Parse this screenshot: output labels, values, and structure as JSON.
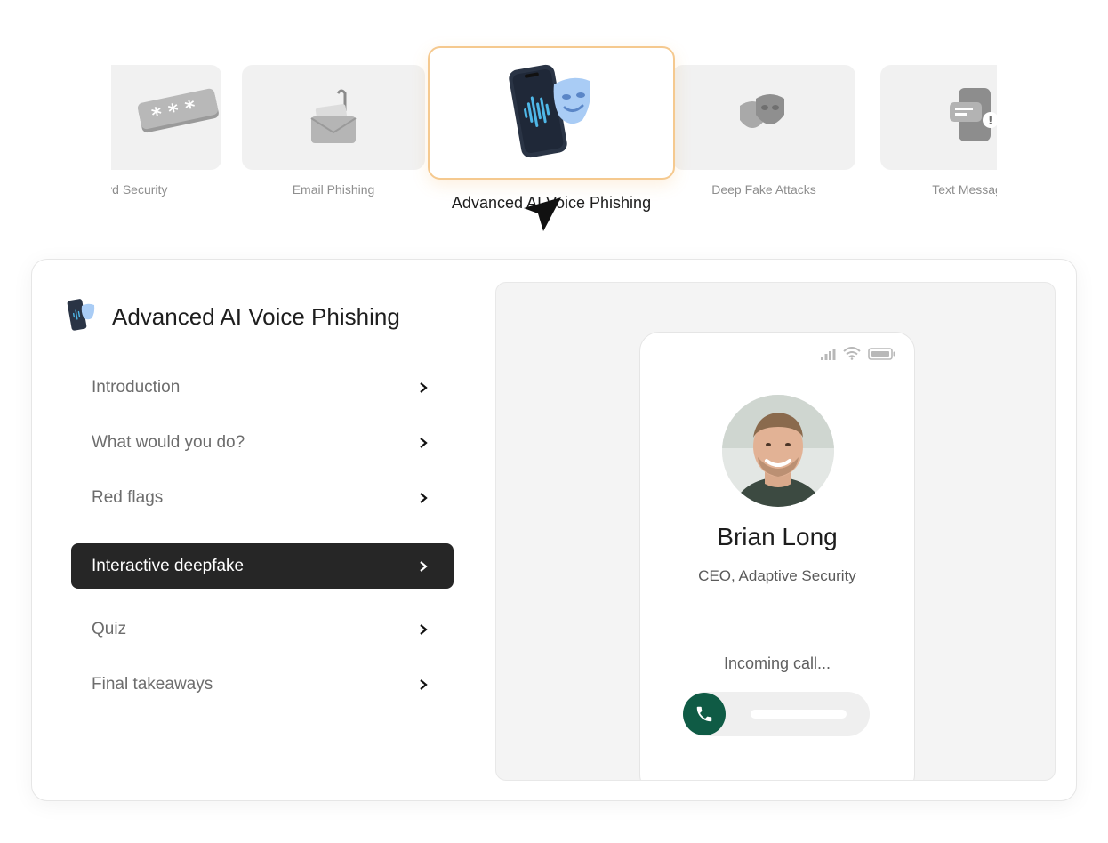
{
  "carousel": {
    "cards": [
      {
        "label": "word Security",
        "icon": "password-icon"
      },
      {
        "label": "Email Phishing",
        "icon": "envelope-hook-icon"
      },
      {
        "label": "Advanced AI Voice Phishing",
        "icon": "phone-mask-icon",
        "selected": true
      },
      {
        "label": "Deep Fake Attacks",
        "icon": "masks-icon"
      },
      {
        "label": "Text Messagin",
        "icon": "chat-phone-icon"
      }
    ]
  },
  "panel": {
    "title": "Advanced AI Voice Phishing",
    "menu": [
      {
        "label": "Introduction"
      },
      {
        "label": "What would you do?"
      },
      {
        "label": "Red flags"
      },
      {
        "label": "Interactive deepfake",
        "active": true
      },
      {
        "label": "Quiz"
      },
      {
        "label": "Final takeaways"
      }
    ]
  },
  "phone": {
    "caller_name": "Brian Long",
    "caller_role": "CEO, Adaptive Security",
    "call_status": "Incoming call...",
    "accent": "#0f5b45"
  },
  "colors": {
    "active_card_border": "#f5c98f",
    "active_menu_bg": "#262626"
  }
}
